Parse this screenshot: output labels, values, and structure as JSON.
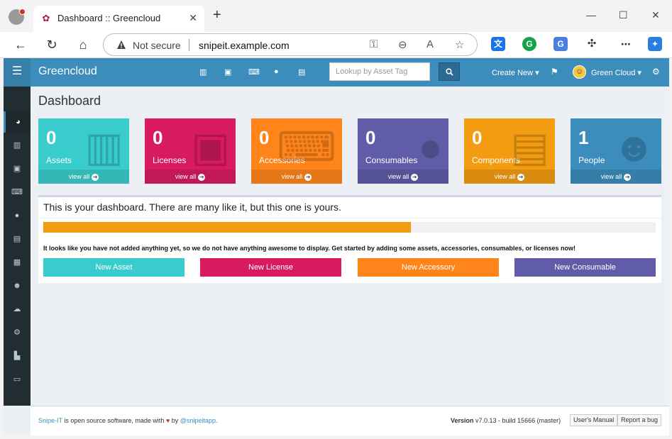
{
  "browser": {
    "tab_title": "Dashboard :: Greencloud",
    "security_label": "Not secure",
    "url": "snipeit.example.com"
  },
  "app": {
    "brand": "Greencloud",
    "search_placeholder": "Lookup by Asset Tag",
    "create_new": "Create New ▾",
    "user_name": "Green Cloud ▾",
    "page_title": "Dashboard",
    "colors": {
      "header": "#3c8dbc",
      "sidebar": "#222d32",
      "assets": "#39cccc",
      "licenses": "#d81b60",
      "accessories": "#ff851b",
      "consumables": "#605ca8",
      "components": "#f39c12",
      "people": "#3c8dbc"
    }
  },
  "stats": [
    {
      "count": "0",
      "label": "Assets",
      "link": "view all",
      "icon": "barcode-icon"
    },
    {
      "count": "0",
      "label": "Licenses",
      "link": "view all",
      "icon": "floppy-disk-icon"
    },
    {
      "count": "0",
      "label": "Accessories",
      "link": "view all",
      "icon": "keyboard-icon"
    },
    {
      "count": "0",
      "label": "Consumables",
      "link": "view all",
      "icon": "droplet-icon"
    },
    {
      "count": "0",
      "label": "Components",
      "link": "view all",
      "icon": "hard-drive-icon"
    },
    {
      "count": "1",
      "label": "People",
      "link": "view all",
      "icon": "users-icon"
    }
  ],
  "panel": {
    "title": "This is your dashboard. There are many like it, but this one is yours.",
    "progress_percent": 60,
    "message": "It looks like you have not added anything yet, so we do not have anything awesome to display. Get started by adding some assets, accessories, consumables, or licenses now!",
    "buttons": [
      "New Asset",
      "New License",
      "New Accessory",
      "New Consumable"
    ]
  },
  "footer": {
    "snipe": "Snipe-IT",
    "text1": " is open source software, made with ",
    "heart": "♥",
    "text2": " by ",
    "handle": "@snipeitapp",
    "period": ".",
    "version_label": "Version",
    "version": " v7.0.13 - build 15666 (master)",
    "manual": "User's Manual",
    "bug": "Report a bug"
  }
}
